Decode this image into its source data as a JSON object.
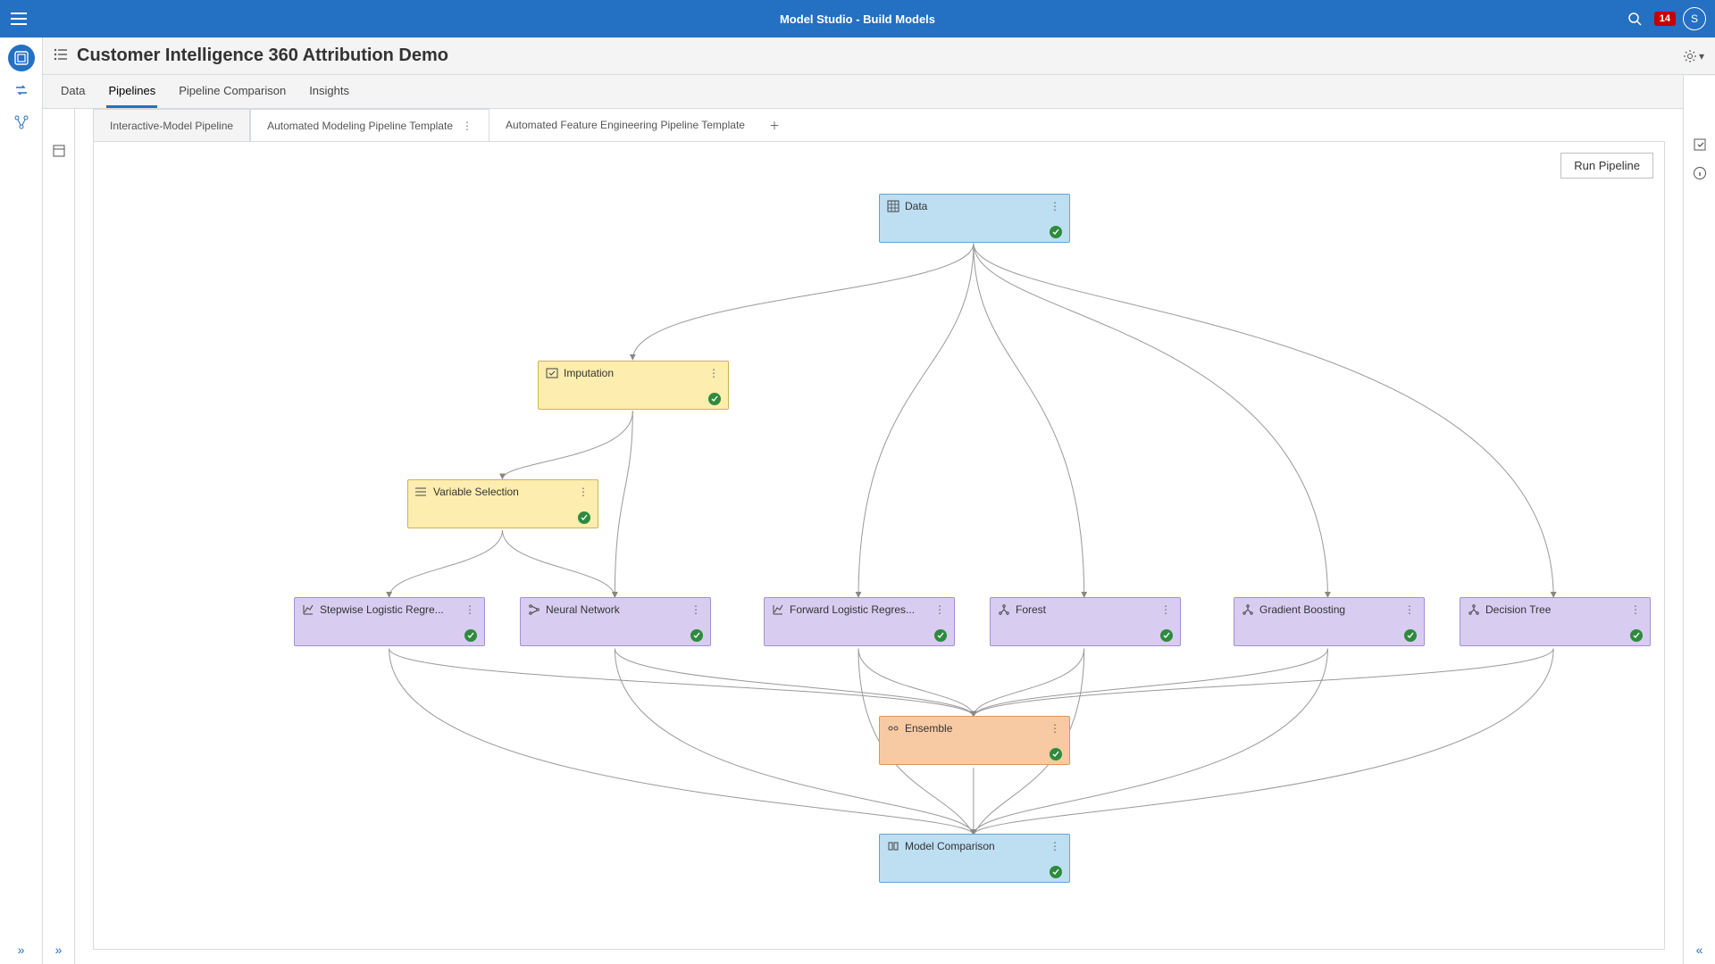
{
  "banner": {
    "title": "Model Studio - Build Models",
    "notifications": "14",
    "avatarLetter": "S"
  },
  "header": {
    "title": "Customer Intelligence 360 Attribution Demo"
  },
  "tabs": {
    "main": [
      {
        "label": "Data"
      },
      {
        "label": "Pipelines",
        "active": true
      },
      {
        "label": "Pipeline Comparison"
      },
      {
        "label": "Insights"
      }
    ],
    "pipeline": [
      {
        "label": "Interactive-Model Pipeline"
      },
      {
        "label": "Automated Modeling Pipeline Template",
        "active": true
      },
      {
        "label": "Automated Feature Engineering Pipeline Template"
      }
    ]
  },
  "buttons": {
    "run": "Run Pipeline"
  },
  "nodes": {
    "data": {
      "label": "Data"
    },
    "imputation": {
      "label": "Imputation"
    },
    "varsel": {
      "label": "Variable Selection"
    },
    "stepwise": {
      "label": "Stepwise Logistic Regre..."
    },
    "neural": {
      "label": "Neural Network"
    },
    "forward": {
      "label": "Forward Logistic Regres..."
    },
    "forest": {
      "label": "Forest"
    },
    "gboost": {
      "label": "Gradient Boosting"
    },
    "dtree": {
      "label": "Decision Tree"
    },
    "ensemble": {
      "label": "Ensemble"
    },
    "compare": {
      "label": "Model Comparison"
    }
  }
}
